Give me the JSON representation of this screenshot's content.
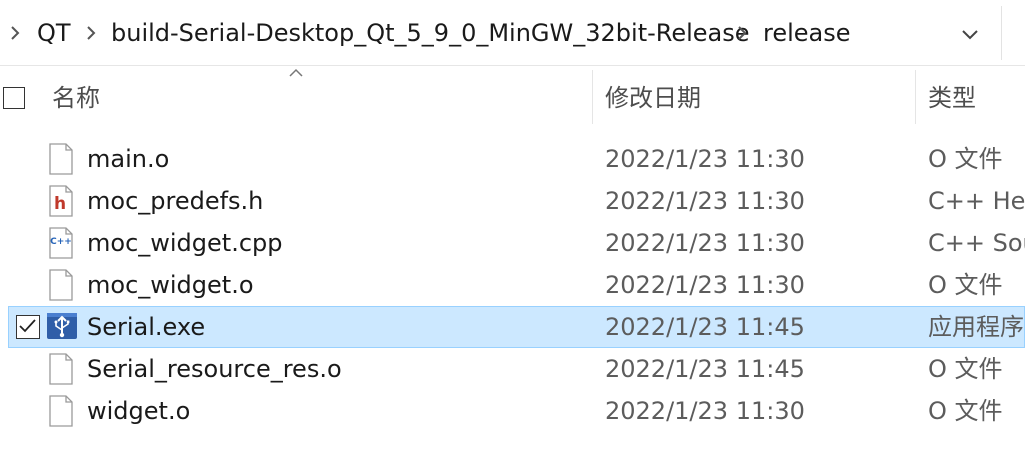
{
  "breadcrumb": [
    "QT",
    "build-Serial-Desktop_Qt_5_9_0_MinGW_32bit-Release",
    "release"
  ],
  "columns": {
    "name": "名称",
    "date": "修改日期",
    "type": "类型"
  },
  "files": [
    {
      "name": "main.o",
      "date": "2022/1/23 11:30",
      "type": "O 文件",
      "icon": "blank-file-icon",
      "selected": false
    },
    {
      "name": "moc_predefs.h",
      "date": "2022/1/23 11:30",
      "type": "C++ Hea",
      "icon": "header-file-icon",
      "selected": false
    },
    {
      "name": "moc_widget.cpp",
      "date": "2022/1/23 11:30",
      "type": "C++ Sou",
      "icon": "cpp-file-icon",
      "selected": false
    },
    {
      "name": "moc_widget.o",
      "date": "2022/1/23 11:30",
      "type": "O 文件",
      "icon": "blank-file-icon",
      "selected": false
    },
    {
      "name": "Serial.exe",
      "date": "2022/1/23 11:45",
      "type": "应用程序",
      "icon": "usb-exe-icon",
      "selected": true
    },
    {
      "name": "Serial_resource_res.o",
      "date": "2022/1/23 11:45",
      "type": "O 文件",
      "icon": "blank-file-icon",
      "selected": false
    },
    {
      "name": "widget.o",
      "date": "2022/1/23 11:30",
      "type": "O 文件",
      "icon": "blank-file-icon",
      "selected": false
    }
  ],
  "colors": {
    "selection_bg": "#cce8ff",
    "selection_border": "#99d1ff",
    "header_text": "#4d4d4d"
  }
}
